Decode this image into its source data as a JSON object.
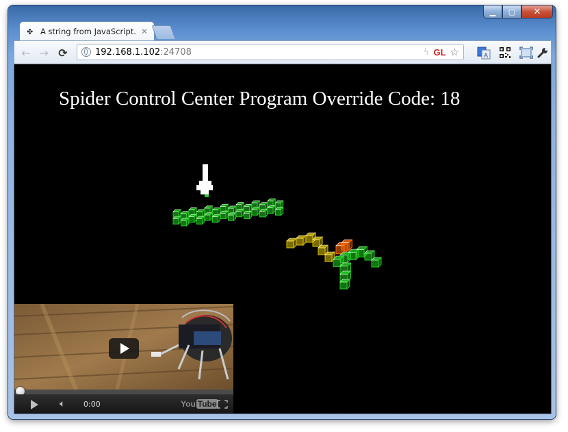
{
  "tab": {
    "title": "A string from JavaScript.",
    "favicon": "puzzle-piece-icon",
    "close_glyph": "✕"
  },
  "toolbar": {
    "back_glyph": "←",
    "forward_glyph": "→",
    "reload_glyph": "⟳",
    "url_host": "192.168.1.102",
    "url_port": ":24708",
    "gl_badge": "GL"
  },
  "page": {
    "headline": "Spider Control Center Program Override Code: 18"
  },
  "video": {
    "time": "0:00",
    "progress": 0,
    "brand_you": "You",
    "brand_tube": "Tube"
  },
  "colors": {
    "accent_red": "#c4161b",
    "cube_green": "#22cc22",
    "cube_yellow": "#e0c400",
    "cube_orange": "#ff6a00"
  }
}
